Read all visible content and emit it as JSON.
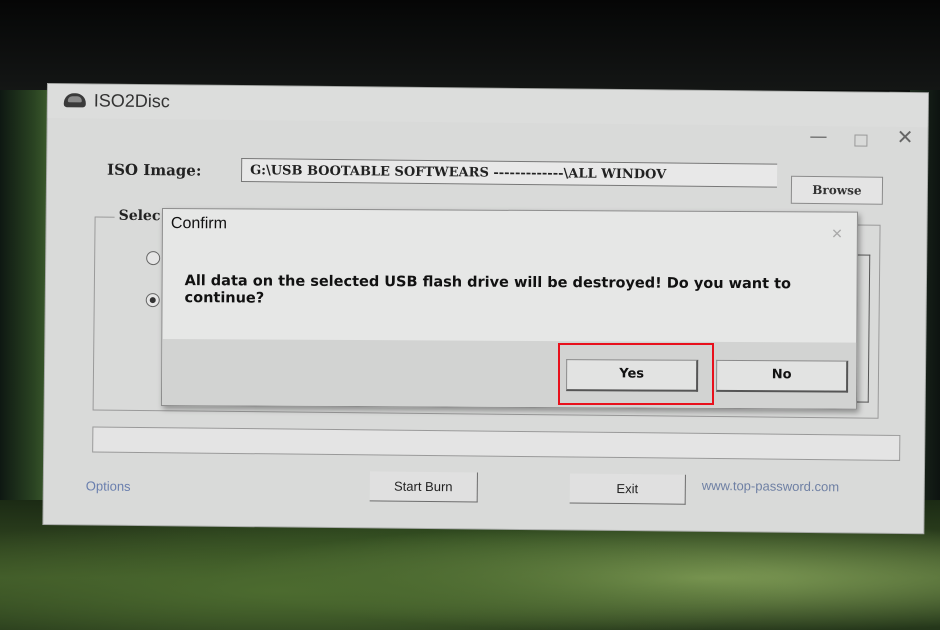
{
  "window": {
    "title": "ISO2Disc",
    "minimize_glyph": "—",
    "close_glyph": "✕"
  },
  "form": {
    "iso_label": "ISO Image:",
    "iso_path": "G:\\USB BOOTABLE   SOFTWEARS -------------\\ALL WINDOV",
    "browse_label": "Browse",
    "group_label": "Selec"
  },
  "footer": {
    "options_label": "Options",
    "start_label": "Start Burn",
    "exit_label": "Exit",
    "website": "www.top-password.com"
  },
  "dialog": {
    "title": "Confirm",
    "close_glyph": "✕",
    "message": "All data on the selected USB flash drive will be destroyed! Do you want to continue?",
    "yes_label": "Yes",
    "no_label": "No"
  },
  "colors": {
    "highlight": "#e8101c",
    "link": "#6a7fae"
  }
}
